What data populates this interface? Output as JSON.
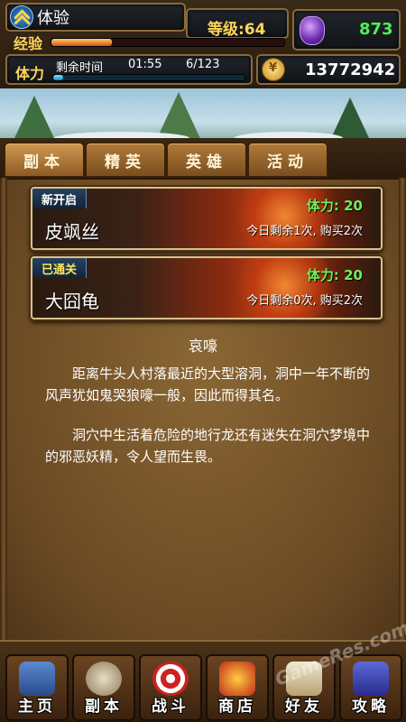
{
  "player": {
    "name": "体验",
    "level_text": "等级:64",
    "exp_label": "经验",
    "exp_progress": 0.26
  },
  "gems": "873",
  "stamina": {
    "label": "体力",
    "remain_label": "剩余时间",
    "timer": "01:55",
    "count": "6/123",
    "progress": 0.05
  },
  "gold": "13772942",
  "tabs": [
    {
      "label": "副本"
    },
    {
      "label": "精英"
    },
    {
      "label": "英雄"
    },
    {
      "label": "活动"
    }
  ],
  "dungeons": [
    {
      "badge": "新开启",
      "name": "皮飒丝",
      "stamina": "体力: 20",
      "remain": "今日剩余1次, 购买2次"
    },
    {
      "badge": "已通关",
      "name": "大囧龟",
      "stamina": "体力: 20",
      "remain": "今日剩余0次, 购买2次"
    }
  ],
  "description": {
    "title": "哀嚎",
    "p1": "距离牛头人村落最近的大型溶洞，洞中一年不断的风声犹如鬼哭狼嚎一般，因此而得其名。",
    "p2": "洞穴中生活着危险的地行龙还有迷失在洞穴梦境中的邪恶妖精，令人望而生畏。"
  },
  "nav": [
    {
      "label": "主页",
      "icon": "home-icon"
    },
    {
      "label": "副本",
      "icon": "skull-icon"
    },
    {
      "label": "战斗",
      "icon": "target-icon"
    },
    {
      "label": "商店",
      "icon": "shop-icon"
    },
    {
      "label": "好友",
      "icon": "friends-icon"
    },
    {
      "label": "攻略",
      "icon": "wizard-icon"
    }
  ],
  "watermark": "GameRes.com"
}
